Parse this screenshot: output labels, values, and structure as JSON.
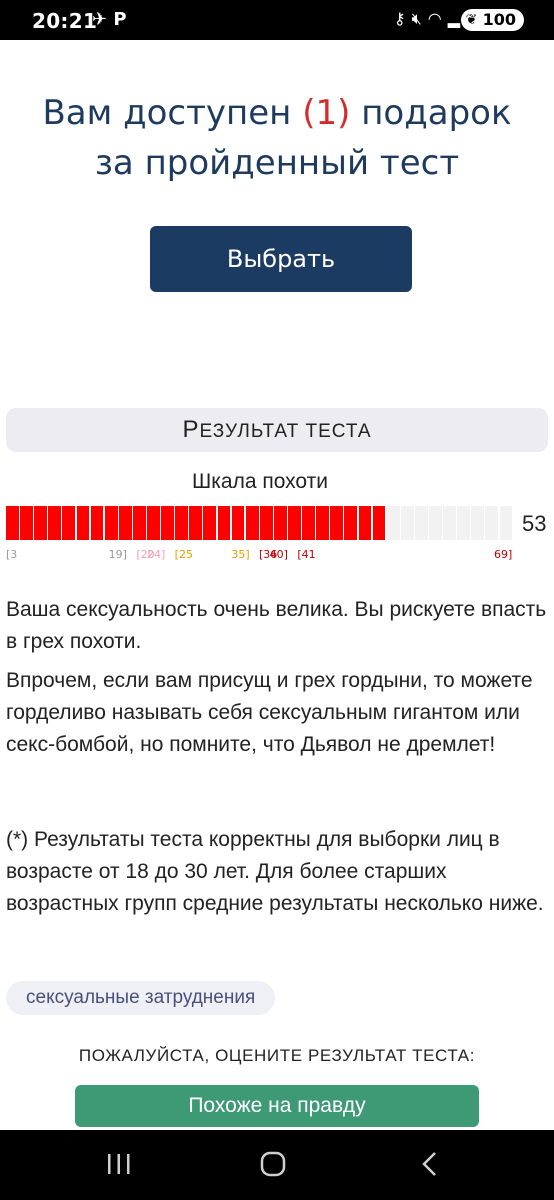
{
  "status_bar": {
    "time": "20:21",
    "battery": "100",
    "left_icons": [
      "telegram-icon",
      "p-app-icon"
    ],
    "right_icons": [
      "key-icon",
      "mute-icon",
      "wifi-icon",
      "signal-icon"
    ]
  },
  "gift": {
    "title_before": "Вам доступен ",
    "count": "(1)",
    "title_after_line1": " подарок",
    "title_line2": "за пройденный тест",
    "choose_button": "Выбрать",
    "count_color": "#d62b2b",
    "button_color": "#1c3b63"
  },
  "result": {
    "header_first_letter": "Р",
    "header_rest": "езультат теста",
    "scale_title": "Шкала похоти",
    "scale_value": "53",
    "scale_fraction": 0.76,
    "scale_fill_color": "#ff0000",
    "ticks": [
      {
        "text": "[3",
        "color": "#999999"
      },
      {
        "text": "19]",
        "color": "#999999"
      },
      {
        "text": "[20",
        "color": "#f2a0b8"
      },
      {
        "text": "24]",
        "color": "#f2a0b8"
      },
      {
        "text": "[25",
        "color": "#e0a000"
      },
      {
        "text": "35]",
        "color": "#e0a000"
      },
      {
        "text": "[36",
        "color": "#c00000"
      },
      {
        "text": "40]",
        "color": "#c00000"
      },
      {
        "text": "[41",
        "color": "#c00000"
      },
      {
        "text": "69]",
        "color": "#c00000"
      }
    ],
    "paragraph1": "Ваша сексуальность очень велика. Вы рискуете впасть в грех похоти.",
    "paragraph2": "Впрочем, если вам присущ и грех гордыни, то можете горделиво называть себя сексуальным гигантом или секс-бомбой, но помните, что Дьявол не дремлет!",
    "paragraph3": "(*) Результаты теста корректны для выборки лиц в возрасте от 18 до 30 лет. Для более старших возрастных групп средние результаты несколько ниже.",
    "tag": "сексуальные затруднения",
    "rate_label": "ПОЖАЛУЙСТА, ОЦЕНИТЕ РЕЗУЛЬТАТ ТЕСТА:",
    "rate_button": "Похоже на правду",
    "rate_button_color": "#3d9a75"
  },
  "nav": {
    "recent": "recent-apps-icon",
    "home": "home-icon",
    "back": "back-icon"
  }
}
